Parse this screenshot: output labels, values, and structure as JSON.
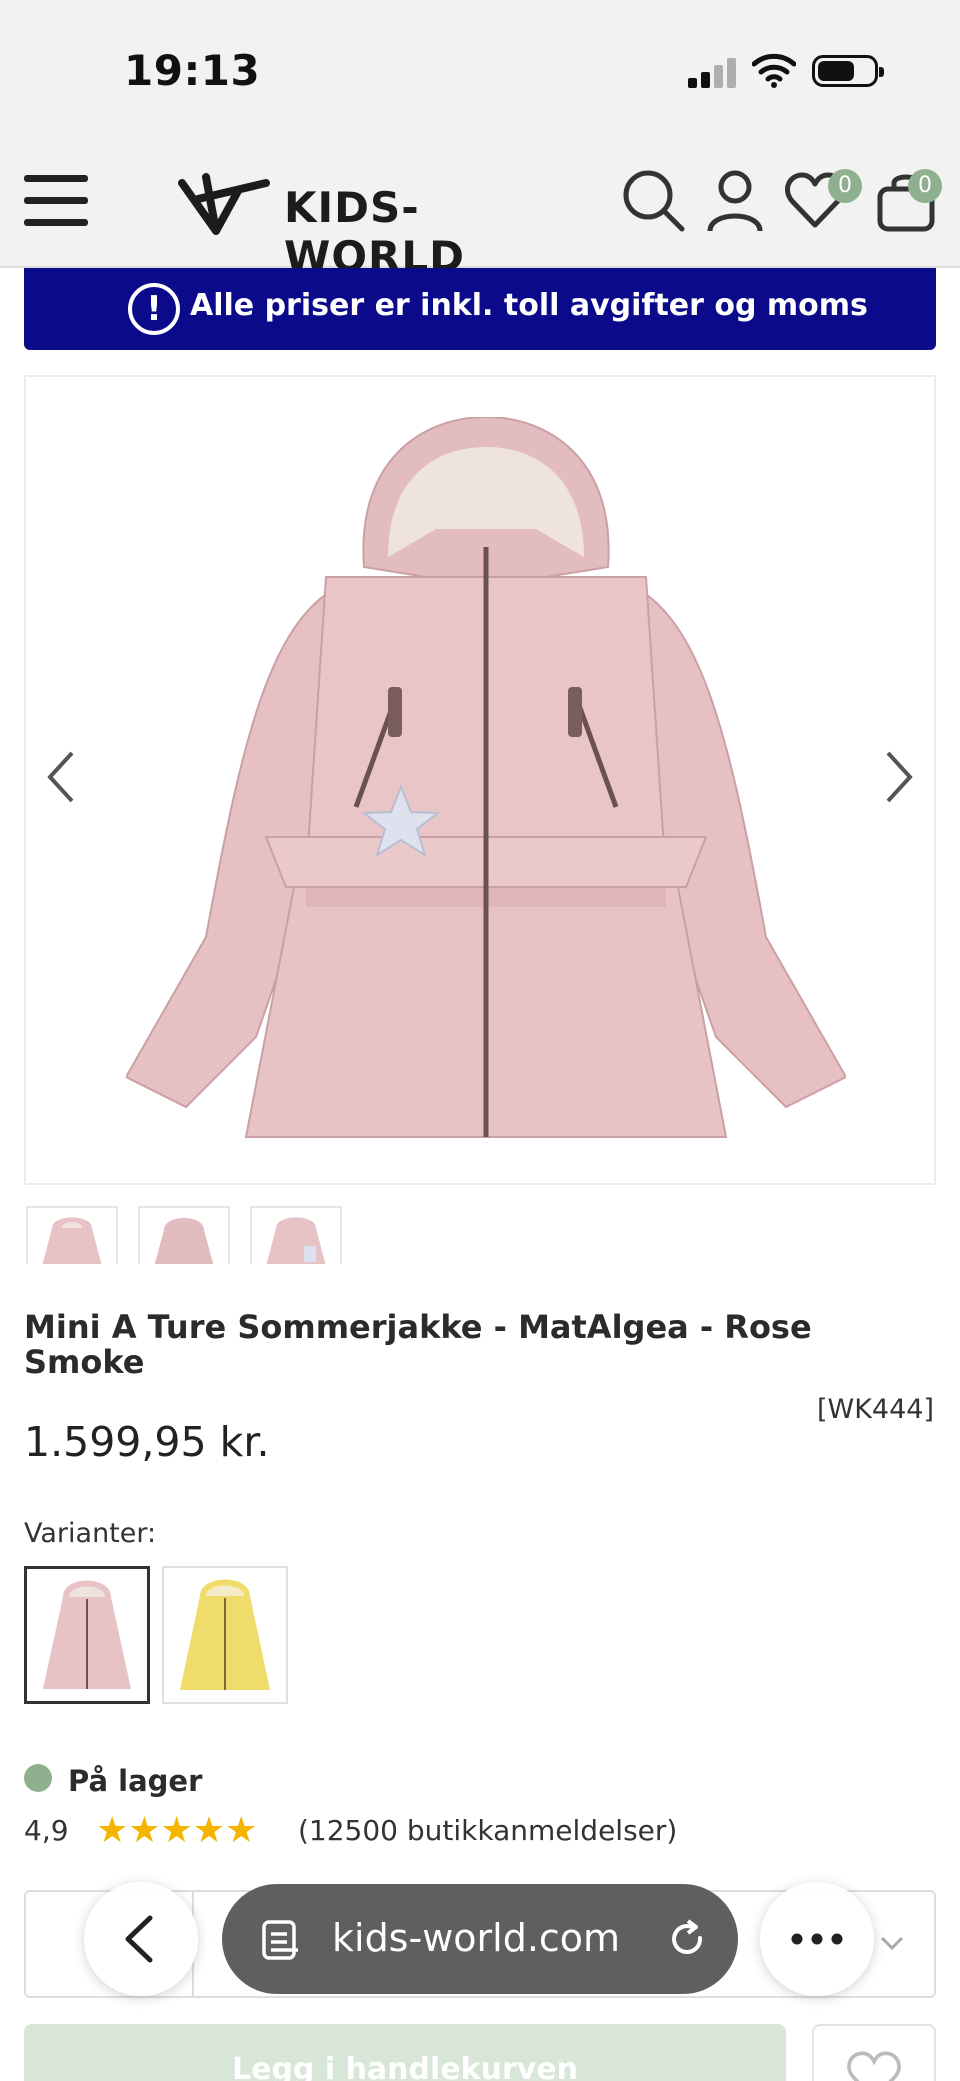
{
  "status_bar": {
    "time": "19:13"
  },
  "header": {
    "brand": "KIDS-WORLD",
    "wishlist_count": "0",
    "cart_count": "0"
  },
  "banner": {
    "icon_glyph": "!",
    "text": "Alle priser er inkl. toll avgifter og moms"
  },
  "product": {
    "title": "Mini A Ture Sommerjakke - MatAlgea - Rose Smoke",
    "sku": "[WK444]",
    "price": "1.599,95 kr.",
    "variants_label": "Varianter:",
    "variants": [
      {
        "color": "#e8c3c6",
        "selected": true
      },
      {
        "color": "#efdc6a",
        "selected": false
      }
    ],
    "stock": "På lager",
    "rating": "4,9",
    "stars": "★★★★★",
    "reviews": "(12500 butikkanmeldelser)",
    "add_to_cart": "Legg i handlekurven"
  },
  "colors": {
    "banner_bg": "#0a0a8a",
    "badge": "#8fb08f",
    "jacket": "#e8c3c6",
    "stars": "#f5b400"
  },
  "browser": {
    "url": "kids-world.com"
  }
}
